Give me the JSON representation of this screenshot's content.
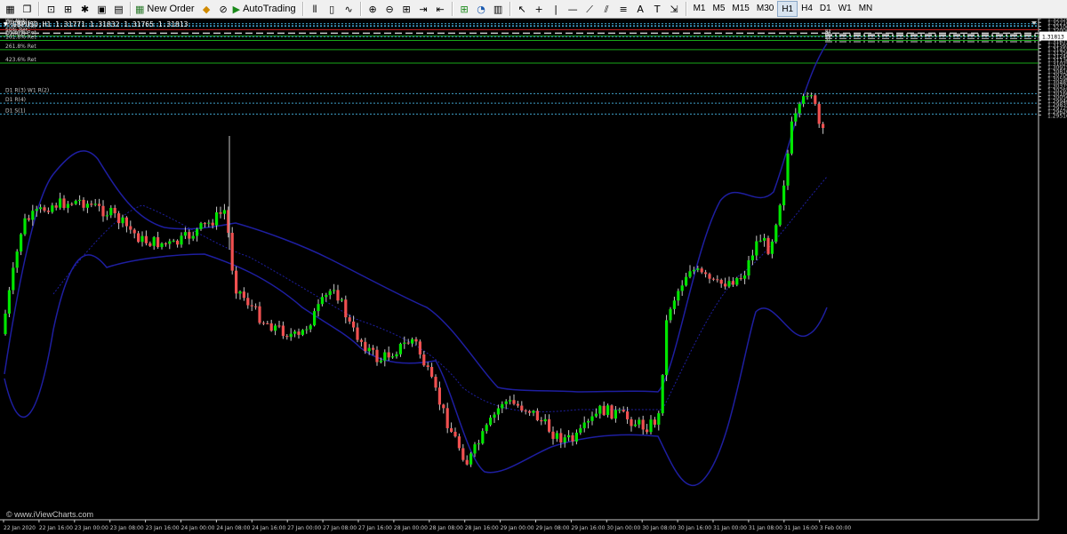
{
  "toolbar": {
    "new_order": "New Order",
    "autotrading": "AutoTrading",
    "timeframes": [
      "M1",
      "M5",
      "M15",
      "M30",
      "H1",
      "H4",
      "D1",
      "W1",
      "MN"
    ],
    "active_timeframe": "H1"
  },
  "chart": {
    "symbol_info": "GBPUSD,H1  1.31771 1.31832 1.31765 1.31813",
    "watermark": "© www.iViewCharts.com",
    "current_price": "1.31813",
    "price_ticks": [
      "1.32320",
      "1.32210",
      "1.32100",
      "1.32000",
      "1.31890",
      "1.31780",
      "1.31675",
      "1.31565",
      "1.31455",
      "1.31350",
      "1.31240",
      "1.31130",
      "1.31025",
      "1.30915",
      "1.30810",
      "1.30700",
      "1.30590",
      "1.30485",
      "1.30375",
      "1.30265",
      "1.30160",
      "1.30050",
      "1.29940",
      "1.29835",
      "1.29725",
      "1.29620",
      "1.29510"
    ],
    "time_ticks": [
      "22 Jan 2020",
      "22 Jan 16:00",
      "23 Jan 00:00",
      "23 Jan 08:00",
      "23 Jan 16:00",
      "24 Jan 00:00",
      "24 Jan 08:00",
      "24 Jan 16:00",
      "27 Jan 00:00",
      "27 Jan 08:00",
      "27 Jan 16:00",
      "28 Jan 00:00",
      "28 Jan 08:00",
      "28 Jan 16:00",
      "29 Jan 00:00",
      "29 Jan 08:00",
      "29 Jan 16:00",
      "30 Jan 00:00",
      "30 Jan 08:00",
      "30 Jan 16:00",
      "31 Jan 00:00",
      "31 Jan 08:00",
      "31 Jan 16:00",
      "3 Feb 00:00"
    ],
    "levels": [
      {
        "label": "W1 R(4)",
        "price": 1.32175,
        "color": "#3fa0c8",
        "style": "dotted"
      },
      {
        "label": "D1 R(1)",
        "price": 1.32115,
        "color": "#3fa0c8",
        "style": "dotted"
      },
      {
        "label": "161.8% Ext",
        "price": 1.32098,
        "color": "#3fa0c8",
        "style": "dotted"
      },
      {
        "label": "100.0% Ext",
        "price": 1.32,
        "color": "#c81e1e",
        "style": "solid"
      },
      {
        "label": "50% Ret",
        "price": 1.31895,
        "color": "#c8c8c8",
        "style": "dashed"
      },
      {
        "label": "100.0% Ret",
        "price": 1.31813,
        "color": "#18a818",
        "style": "solid"
      },
      {
        "label": "D1 R(2)",
        "price": 1.31795,
        "color": "#3fa0c8",
        "style": "dotted"
      },
      {
        "label": "161.8% Ret",
        "price": 1.31685,
        "color": "#18a818",
        "style": "solid"
      },
      {
        "label": "261.8% Ret",
        "price": 1.31415,
        "color": "#18a818",
        "style": "solid"
      },
      {
        "label": "423.6% Ret",
        "price": 1.31025,
        "color": "#18a818",
        "style": "solid"
      },
      {
        "label": "D1 R(3)  W1 R(2)",
        "price": 1.30135,
        "color": "#3fa0c8",
        "style": "dotted"
      },
      {
        "label": "D1 R(4)",
        "price": 1.29855,
        "color": "#3fa0c8",
        "style": "dotted"
      },
      {
        "label": "D1 S(1)",
        "price": 1.29538,
        "color": "#3fa0c8",
        "style": "dotted"
      }
    ],
    "pivot_lines": [
      {
        "label": "R2",
        "price": 1.31875,
        "style": "dashdot"
      },
      {
        "label": "R1",
        "price": 1.31838,
        "style": "dashdot"
      },
      {
        "label": "PP",
        "price": 1.31815,
        "style": "dashdot"
      },
      {
        "label": "S1",
        "price": 1.31745,
        "style": "dashdot"
      },
      {
        "label": "S2",
        "price": 1.31645,
        "style": "dashdot"
      }
    ]
  },
  "colors": {
    "background": "#000000",
    "bull": "#00e600",
    "bear": "#f05050",
    "wick": "#c8c8c8",
    "bands": "#1e1ea0",
    "axis_text": "#c8c8c8"
  }
}
